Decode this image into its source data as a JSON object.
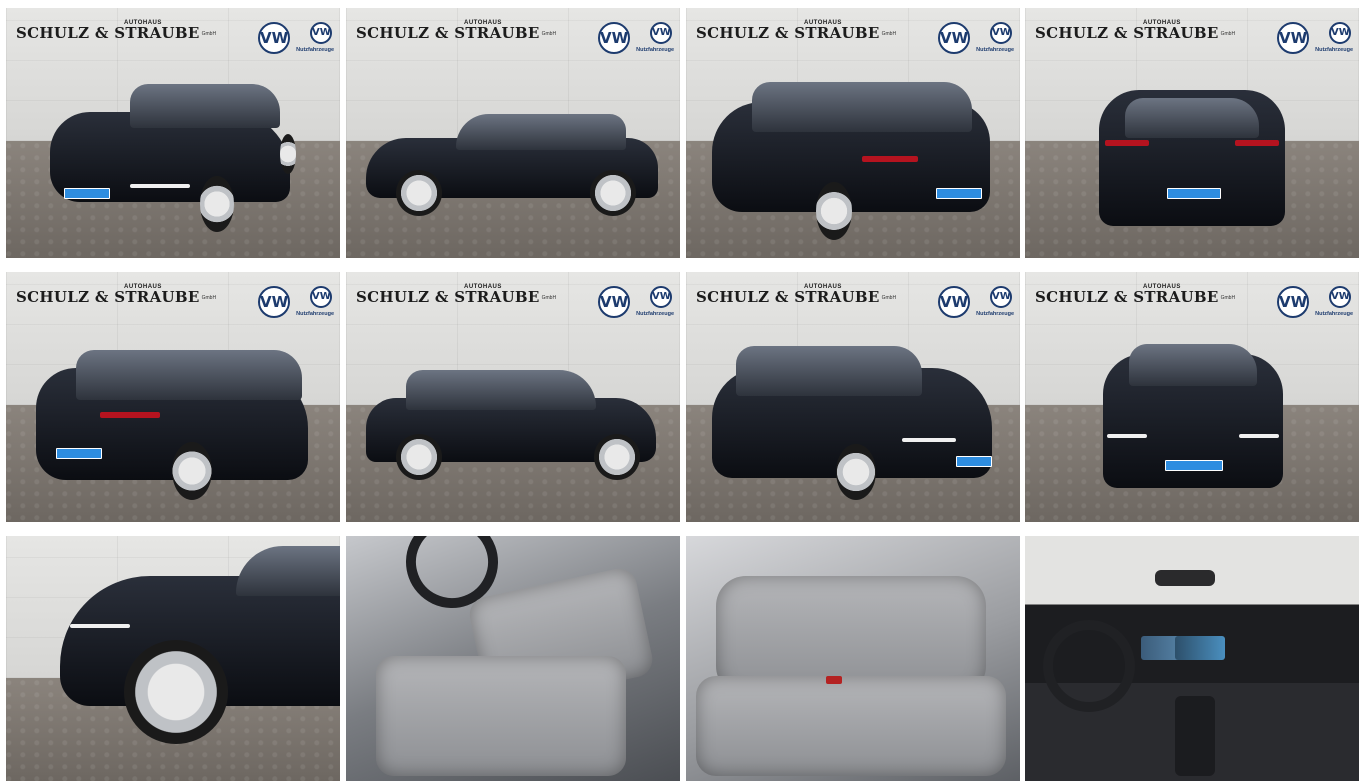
{
  "dealer": {
    "name": "SCHULZ & STRAUBE",
    "prefix": "AUTOHAUS",
    "suffix": "GmbH",
    "brand_logo": "vw-logo",
    "commercial_label": "Nutzfahrzeuge"
  },
  "gallery": {
    "tiles": [
      {
        "view": "front-left"
      },
      {
        "view": "left-side"
      },
      {
        "view": "rear-left"
      },
      {
        "view": "rear"
      },
      {
        "view": "rear-left-2"
      },
      {
        "view": "right-side"
      },
      {
        "view": "front-right"
      },
      {
        "view": "front"
      },
      {
        "view": "front-wheel-detail"
      },
      {
        "view": "driver-seat"
      },
      {
        "view": "rear-seats"
      },
      {
        "view": "dashboard"
      }
    ]
  },
  "colors": {
    "vw_blue": "#1d3b6e",
    "plate_blue": "#2e8de0",
    "car_black": "#0b0d12"
  }
}
